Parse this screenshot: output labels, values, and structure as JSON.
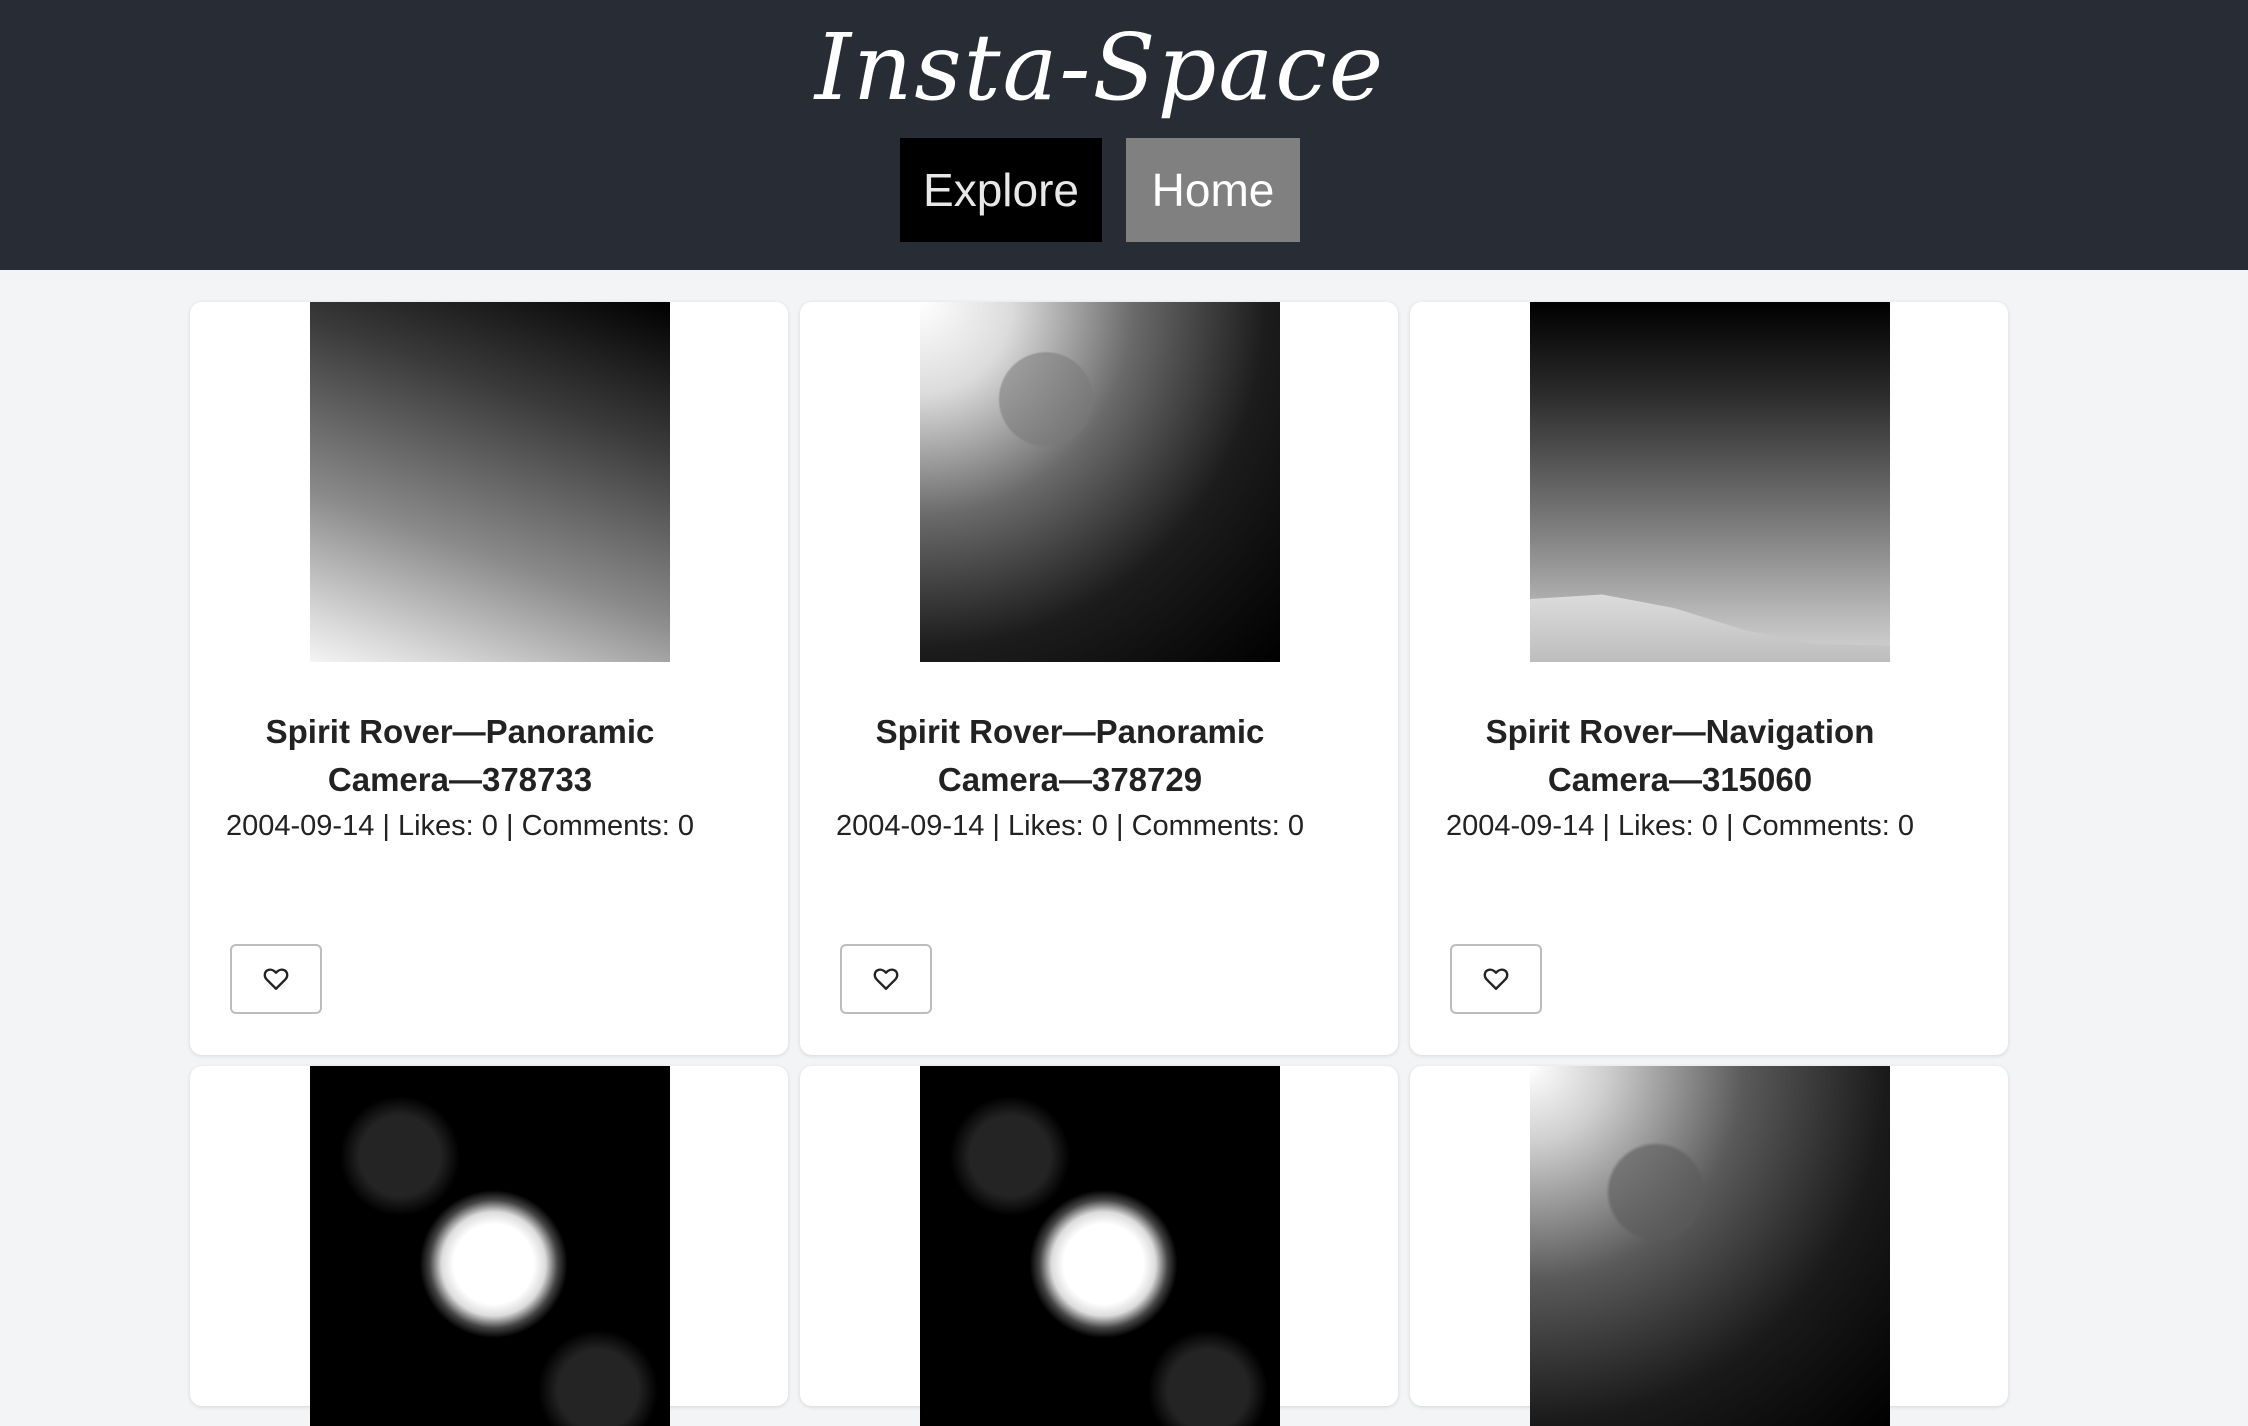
{
  "app": {
    "title": "Insta-Space"
  },
  "nav": {
    "explore_label": "Explore",
    "home_label": "Home"
  },
  "posts": [
    {
      "title": "Spirit Rover—Panoramic Camera—378733",
      "meta": "2004-09-14 | Likes: 0 | Comments: 0"
    },
    {
      "title": "Spirit Rover—Panoramic Camera—378729",
      "meta": "2004-09-14 | Likes: 0 | Comments: 0"
    },
    {
      "title": "Spirit Rover—Navigation Camera—315060",
      "meta": "2004-09-14 | Likes: 0 | Comments: 0"
    },
    {
      "title": "",
      "meta": ""
    },
    {
      "title": "",
      "meta": ""
    },
    {
      "title": "",
      "meta": ""
    }
  ],
  "like_icon": "heart-outline-icon",
  "colors": {
    "header_bg": "#282c34",
    "explore_bg": "#000000",
    "home_bg": "#808080",
    "page_bg": "#f3f4f6"
  }
}
